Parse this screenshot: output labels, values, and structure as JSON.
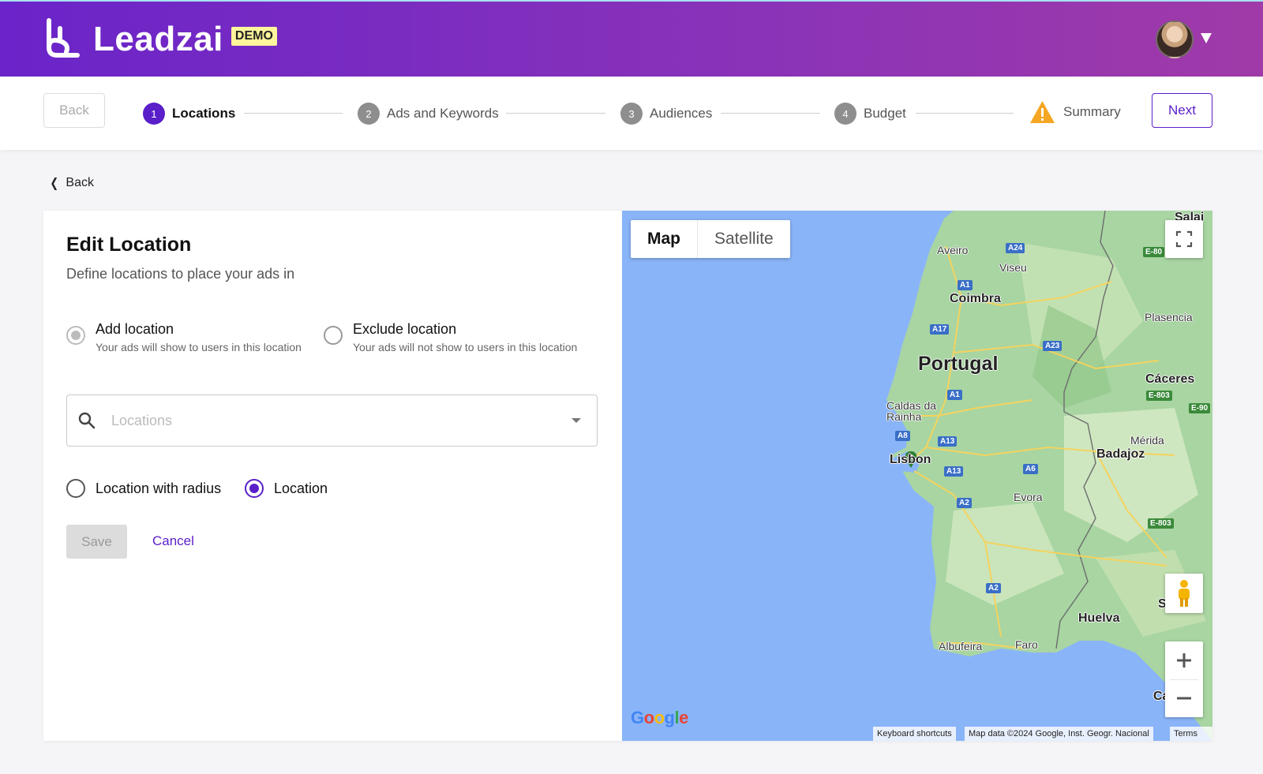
{
  "header": {
    "brand": "Leadzai",
    "badge": "DEMO"
  },
  "stepper": {
    "back_label": "Back",
    "next_label": "Next",
    "steps": [
      {
        "num": "1",
        "label": "Locations"
      },
      {
        "num": "2",
        "label": "Ads and Keywords"
      },
      {
        "num": "3",
        "label": "Audiences"
      },
      {
        "num": "4",
        "label": "Budget"
      },
      {
        "num": "",
        "label": "Summary"
      }
    ]
  },
  "back_link": "Back",
  "form": {
    "title": "Edit Location",
    "subtitle": "Define locations to place your ads in",
    "add_option": {
      "title": "Add location",
      "desc": "Your ads will show to users in this location"
    },
    "exclude_option": {
      "title": "Exclude location",
      "desc": "Your ads will not show to users in this location"
    },
    "search": {
      "placeholder": "Locations",
      "value": ""
    },
    "mode_radius": "Location with radius",
    "mode_location": "Location",
    "save_label": "Save",
    "cancel_label": "Cancel"
  },
  "map": {
    "tab_map": "Map",
    "tab_satellite": "Satellite",
    "country": "Portugal",
    "labels": {
      "aveiro": "Aveiro",
      "viseu": "Viseu",
      "coimbra": "Coimbra",
      "plasencia": "Plasencia",
      "caceres": "Cáceres",
      "caldas": "Caldas da\nRainha",
      "lisbon": "Lisbon",
      "merida": "Mérida",
      "badajoz": "Badajoz",
      "evora": "Evora",
      "huelva": "Huelva",
      "albufeira": "Albufeira",
      "faro": "Faro",
      "sevilla": "Sevilla",
      "salamanca": "Salai",
      "cadiz": "Các"
    },
    "roads": [
      "A24",
      "A1",
      "A17",
      "A23",
      "A1",
      "A8",
      "A13",
      "A13",
      "A6",
      "A2",
      "A2",
      "E-80",
      "E-803",
      "E-90",
      "E-803"
    ],
    "google": "Google",
    "attrib_shortcuts": "Keyboard shortcuts",
    "attrib_data": "Map data ©2024 Google, Inst. Geogr. Nacional",
    "attrib_terms": "Terms"
  },
  "colors": {
    "accent": "#5a1fc9",
    "header_start": "#6a24c9",
    "header_end": "#a03aa8",
    "water": "#8ab4f8",
    "land": "#a8d5a2",
    "warning": "#f5a623"
  }
}
